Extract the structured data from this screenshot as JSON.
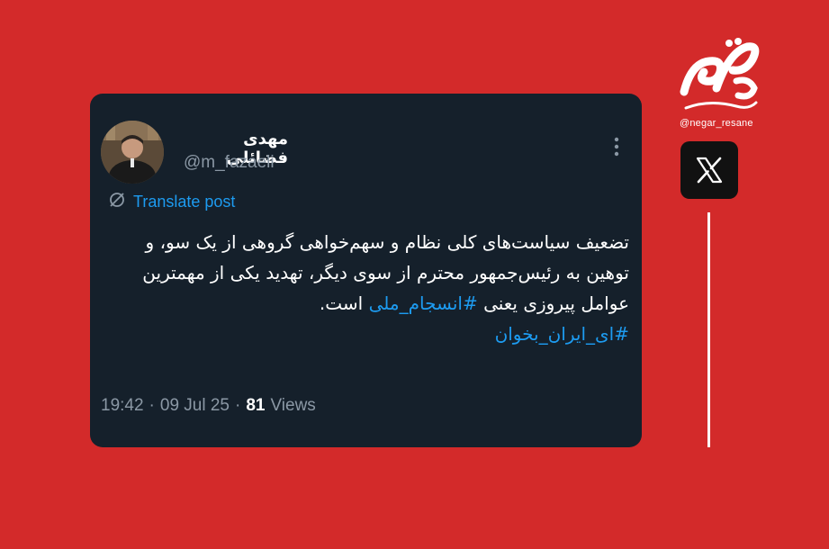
{
  "tweet": {
    "author_name": "مهدی فضائلی",
    "handle": "@m_fazaeli",
    "translate_label": "Translate post",
    "body_line1": "تضعیف سیاست‌های کلی نظام و سهم‌خواهی گروهی از یک سو، و",
    "body_line2": "توهین به رئیس‌جمهور محترم از سوی دیگر، تهدید یکی از مهمترین",
    "body_line3_prefix": "عوامل پیروزی یعنی ",
    "hashtag1": "#انسجام_ملی",
    "body_line3_suffix": " است.",
    "hashtag2": "#ای_ایران_بخوان",
    "time": "19:42",
    "separator1": "·",
    "date": "09 Jul 25",
    "separator2": "·",
    "views_count": "81",
    "views_label": "Views"
  },
  "brand": {
    "handle": "@negar_resane",
    "logo_alt": "نگار روایت متفاوت"
  },
  "icons": {
    "more": "more-vertical-icon",
    "translate": "translate-icon",
    "x": "x-logo-icon"
  },
  "colors": {
    "background": "#d32a2a",
    "card": "#15202b",
    "link": "#1d9bf0",
    "muted": "#8b98a5"
  }
}
